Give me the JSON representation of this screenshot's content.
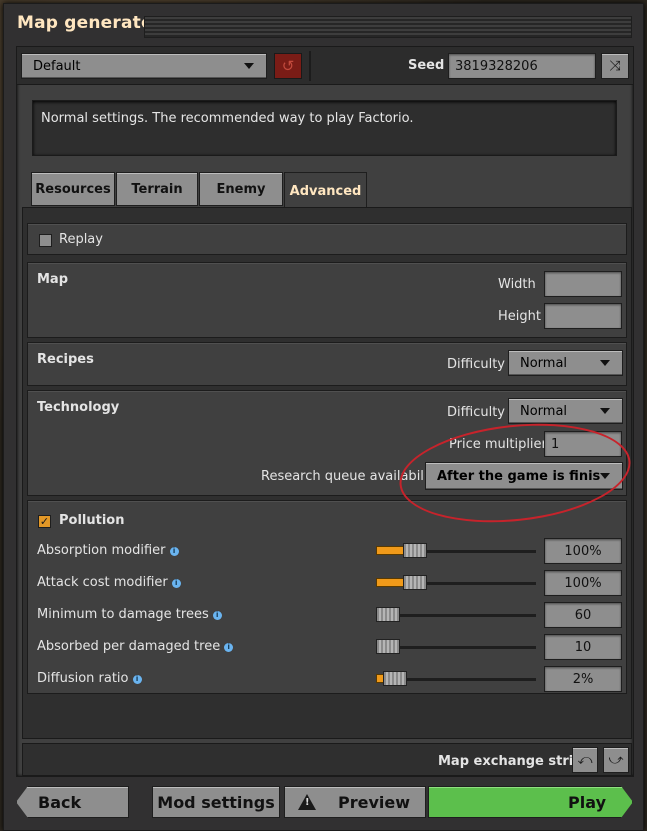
{
  "window": {
    "title": "Map generator"
  },
  "preset": {
    "value": "Default"
  },
  "seed": {
    "label": "Seed",
    "value": "3819328206"
  },
  "description": "Normal settings. The recommended way to play Factorio.",
  "tabs": [
    {
      "label": "Resources",
      "active": false
    },
    {
      "label": "Terrain",
      "active": false
    },
    {
      "label": "Enemy",
      "active": false
    },
    {
      "label": "Advanced",
      "active": true
    }
  ],
  "replay": {
    "label": "Replay",
    "checked": false
  },
  "map": {
    "title": "Map",
    "width_label": "Width",
    "height_label": "Height",
    "width_value": "",
    "height_value": ""
  },
  "recipes": {
    "title": "Recipes",
    "difficulty_label": "Difficulty",
    "difficulty_value": "Normal"
  },
  "technology": {
    "title": "Technology",
    "difficulty_label": "Difficulty",
    "difficulty_value": "Normal",
    "price_label": "Price multiplier",
    "price_value": "1",
    "queue_label": "Research queue availability",
    "queue_value": "After the game is finished"
  },
  "pollution": {
    "title": "Pollution",
    "checked": true,
    "rows": [
      {
        "label": "Absorption modifier",
        "value": "100%",
        "level": 0.2
      },
      {
        "label": "Attack cost modifier",
        "value": "100%",
        "level": 0.2
      },
      {
        "label": "Minimum to damage trees",
        "value": "60",
        "level": 0.0
      },
      {
        "label": "Absorbed per damaged tree",
        "value": "10",
        "level": 0.0
      },
      {
        "label": "Diffusion ratio",
        "value": "2%",
        "level": 0.05
      }
    ]
  },
  "exchange": {
    "label": "Map exchange string"
  },
  "footer": {
    "back": "Back",
    "mod_settings": "Mod settings",
    "preview": "Preview",
    "play": "Play"
  },
  "colors": {
    "accent": "#f09a1a",
    "play_green": "#5cbf4c",
    "title": "#ffe6c0",
    "annotation_red": "#c7232b"
  }
}
